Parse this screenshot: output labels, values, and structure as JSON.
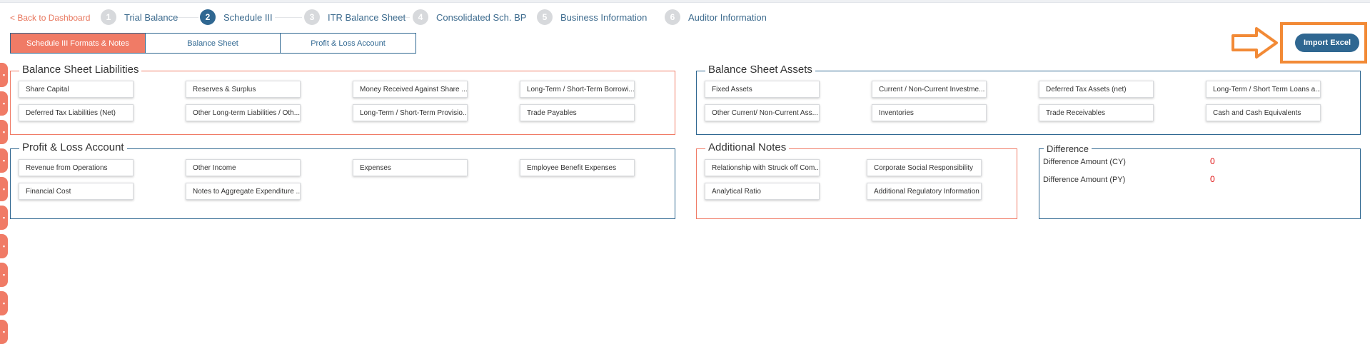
{
  "back_link": "< Back to Dashboard",
  "steps": [
    {
      "num": "1",
      "label": "Trial Balance"
    },
    {
      "num": "2",
      "label": "Schedule III"
    },
    {
      "num": "3",
      "label": "ITR Balance Sheet"
    },
    {
      "num": "4",
      "label": "Consolidated Sch. BP"
    },
    {
      "num": "5",
      "label": "Business Information"
    },
    {
      "num": "6",
      "label": "Auditor Information"
    }
  ],
  "tabs": [
    "Schedule III Formats & Notes",
    "Balance Sheet",
    "Profit & Loss Account"
  ],
  "import_button": "Import Excel",
  "sections": {
    "liabilities": {
      "title": "Balance Sheet Liabilities",
      "items": [
        "Share Capital",
        "Reserves & Surplus",
        "Money Received Against Share ...",
        "Long-Term / Short-Term Borrowi...",
        "Deferred Tax Liabilities (Net)",
        "Other Long-term Liabilities / Oth...",
        "Long-Term / Short-Term Provisio...",
        "Trade Payables"
      ]
    },
    "assets": {
      "title": "Balance Sheet Assets",
      "items": [
        "Fixed Assets",
        "Current / Non-Current Investme...",
        "Deferred Tax Assets (net)",
        "Long-Term / Short Term Loans a...",
        "Other Current/ Non-Current Ass...",
        "Inventories",
        "Trade Receivables",
        "Cash and Cash Equivalents"
      ]
    },
    "pnl": {
      "title": "Profit & Loss Account",
      "items": [
        "Revenue from Operations",
        "Other Income",
        "Expenses",
        "Employee Benefit Expenses",
        "Financial Cost",
        "Notes to Aggregate Expenditure ..."
      ]
    },
    "notes": {
      "title": "Additional Notes",
      "items": [
        "Relationship with Struck off Com...",
        "Corporate Social Responsibility",
        "Analytical Ratio",
        "Additional Regulatory Information"
      ]
    },
    "difference": {
      "title": "Difference",
      "cy_label": "Difference Amount (CY)",
      "cy_value": "0",
      "py_label": "Difference Amount (PY)",
      "py_value": "0"
    }
  },
  "colors": {
    "primary": "#2f6791",
    "accent": "#f07b66",
    "highlight": "#f28a36",
    "error": "#e01010"
  }
}
